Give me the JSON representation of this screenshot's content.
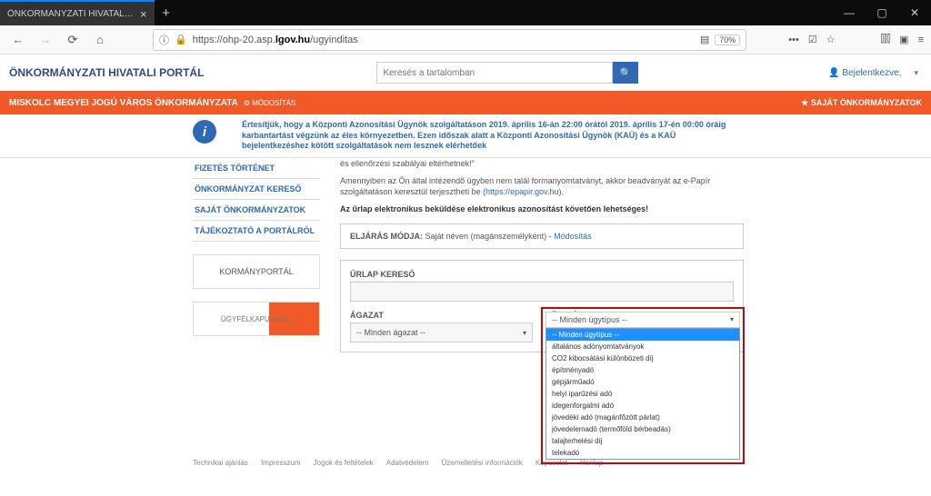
{
  "browser": {
    "tab_title": "ÖNKORMÁNYZATI HIVATALI PORTÁ",
    "url_host": "lgov.hu",
    "url_prefix": "https://ohp-20.asp.",
    "url_path": "/ugyinditas",
    "zoom": "70%"
  },
  "header": {
    "title": "ÖNKORMÁNYZATI HIVATALI PORTÁL",
    "search_placeholder": "Keresés a tartalomban",
    "login": "Bejelentkezve,"
  },
  "orange": {
    "org": "MISKOLC MEGYEI JOGÚ VÁROS ÖNKORMÁNYZATA",
    "mod": "⚙ MÓDOSÍTÁS",
    "right": "SAJÁT ÖNKORMÁNYZATOK"
  },
  "info": "Értesítjük, hogy a Központi Azonosítási Ügynök szolgáltatáson 2019. április 16-án 22:00 órától 2019. április 17-én 00:00 óráig karbantartást végzünk az éles környezetben. Ezen időszak alatt a Központi Azonosítási Ügynök (KAÜ) és a KAÜ bejelentkezéshez kötött szolgáltatások nem lesznek elérhetőek",
  "sidebar": {
    "items": [
      "FIZETÉS TÖRTÉNET",
      "ÖNKORMÁNYZAT KERESŐ",
      "SAJÁT ÖNKORMÁNYZATOK",
      "TÁJÉKOZTATÓ A PORTÁLRÓL"
    ],
    "logo1": "KORMÁNYPORTÁL",
    "logo2": "ÜGYFÉLKAPU mo.hu"
  },
  "body": {
    "line1": "és ellenőrzési szabályai eltérhetnek!\"",
    "line2_a": "Amennyiben az Ön által intézendő ügyben nem talál formanyomtatványt, akkor beadványát az e-Papír szolgáltatáson keresztül terjesztheti be (",
    "line2_link": "https://epapir.gov.hu",
    "line2_b": ").",
    "line3": "Az űrlap elektronikus beküldése elektronikus azonosítást követően lehetséges!",
    "proc_label": "ELJÁRÁS MÓDJA:",
    "proc_value": "Saját néven (magánszemélyként) - ",
    "proc_link": "Módosítás"
  },
  "form": {
    "f1_label": "ŰRLAP KERESŐ",
    "c1_label": "ÁGAZAT",
    "c1_value": "-- Minden ágazat --",
    "c2_label": "ÜGYTÍPUS",
    "c2_value": "-- Minden ügytípus --",
    "options": [
      "-- Minden ügytípus --",
      "általános adónyomtatványok",
      "CO2 kibocsátási különbözeti díj",
      "építményadó",
      "gépjárműadó",
      "helyi iparűzési adó",
      "idegenforgalmi adó",
      "jövedéki adó (magánfőzött párlat)",
      "jövedelemadó (termőföld bérbeadás)",
      "talajterhelési díj",
      "telekadó"
    ]
  },
  "footer": [
    "Technikai ajánlás",
    "Impresszum",
    "Jogok és feltételek",
    "Adatvédelem",
    "Üzemeltetési információk",
    "Kapcsolat",
    "Honlap"
  ]
}
